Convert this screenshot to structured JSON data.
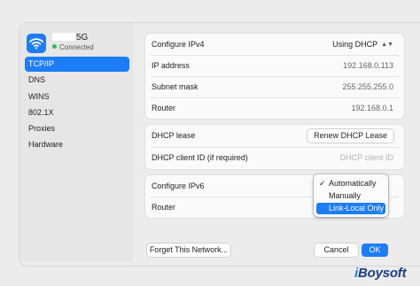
{
  "network": {
    "name_suffix": "5G",
    "status": "Connected",
    "icon": "wifi-icon"
  },
  "sidebar": {
    "items": [
      {
        "label": "TCP/IP",
        "active": true
      },
      {
        "label": "DNS",
        "active": false
      },
      {
        "label": "WINS",
        "active": false
      },
      {
        "label": "802.1X",
        "active": false
      },
      {
        "label": "Proxies",
        "active": false
      },
      {
        "label": "Hardware",
        "active": false
      }
    ]
  },
  "ipv4": {
    "configure_label": "Configure IPv4",
    "configure_value": "Using DHCP",
    "ip_label": "IP address",
    "ip_value": "192.168.0.113",
    "subnet_label": "Subnet mask",
    "subnet_value": "255.255.255.0",
    "router_label": "Router",
    "router_value": "192.168.0.1"
  },
  "dhcp": {
    "lease_label": "DHCP lease",
    "renew_button": "Renew DHCP Lease",
    "client_id_label": "DHCP client ID (if required)",
    "client_id_placeholder": "DHCP client ID"
  },
  "ipv6": {
    "configure_label": "Configure IPv6",
    "router_label": "Router"
  },
  "ipv6_menu": {
    "items": [
      {
        "label": "Automatically",
        "checked": true,
        "highlighted": false
      },
      {
        "label": "Manually",
        "checked": false,
        "highlighted": false
      },
      {
        "label": "Link-Local Only",
        "checked": false,
        "highlighted": true
      }
    ],
    "check_glyph": "✓"
  },
  "footer": {
    "forget_button": "Forget This Network...",
    "cancel_button": "Cancel",
    "ok_button": "OK"
  },
  "watermark": {
    "prefix": "i",
    "brand": "Boysoft"
  },
  "colors": {
    "accent": "#1c7df6",
    "status_green": "#2fbf4d"
  }
}
